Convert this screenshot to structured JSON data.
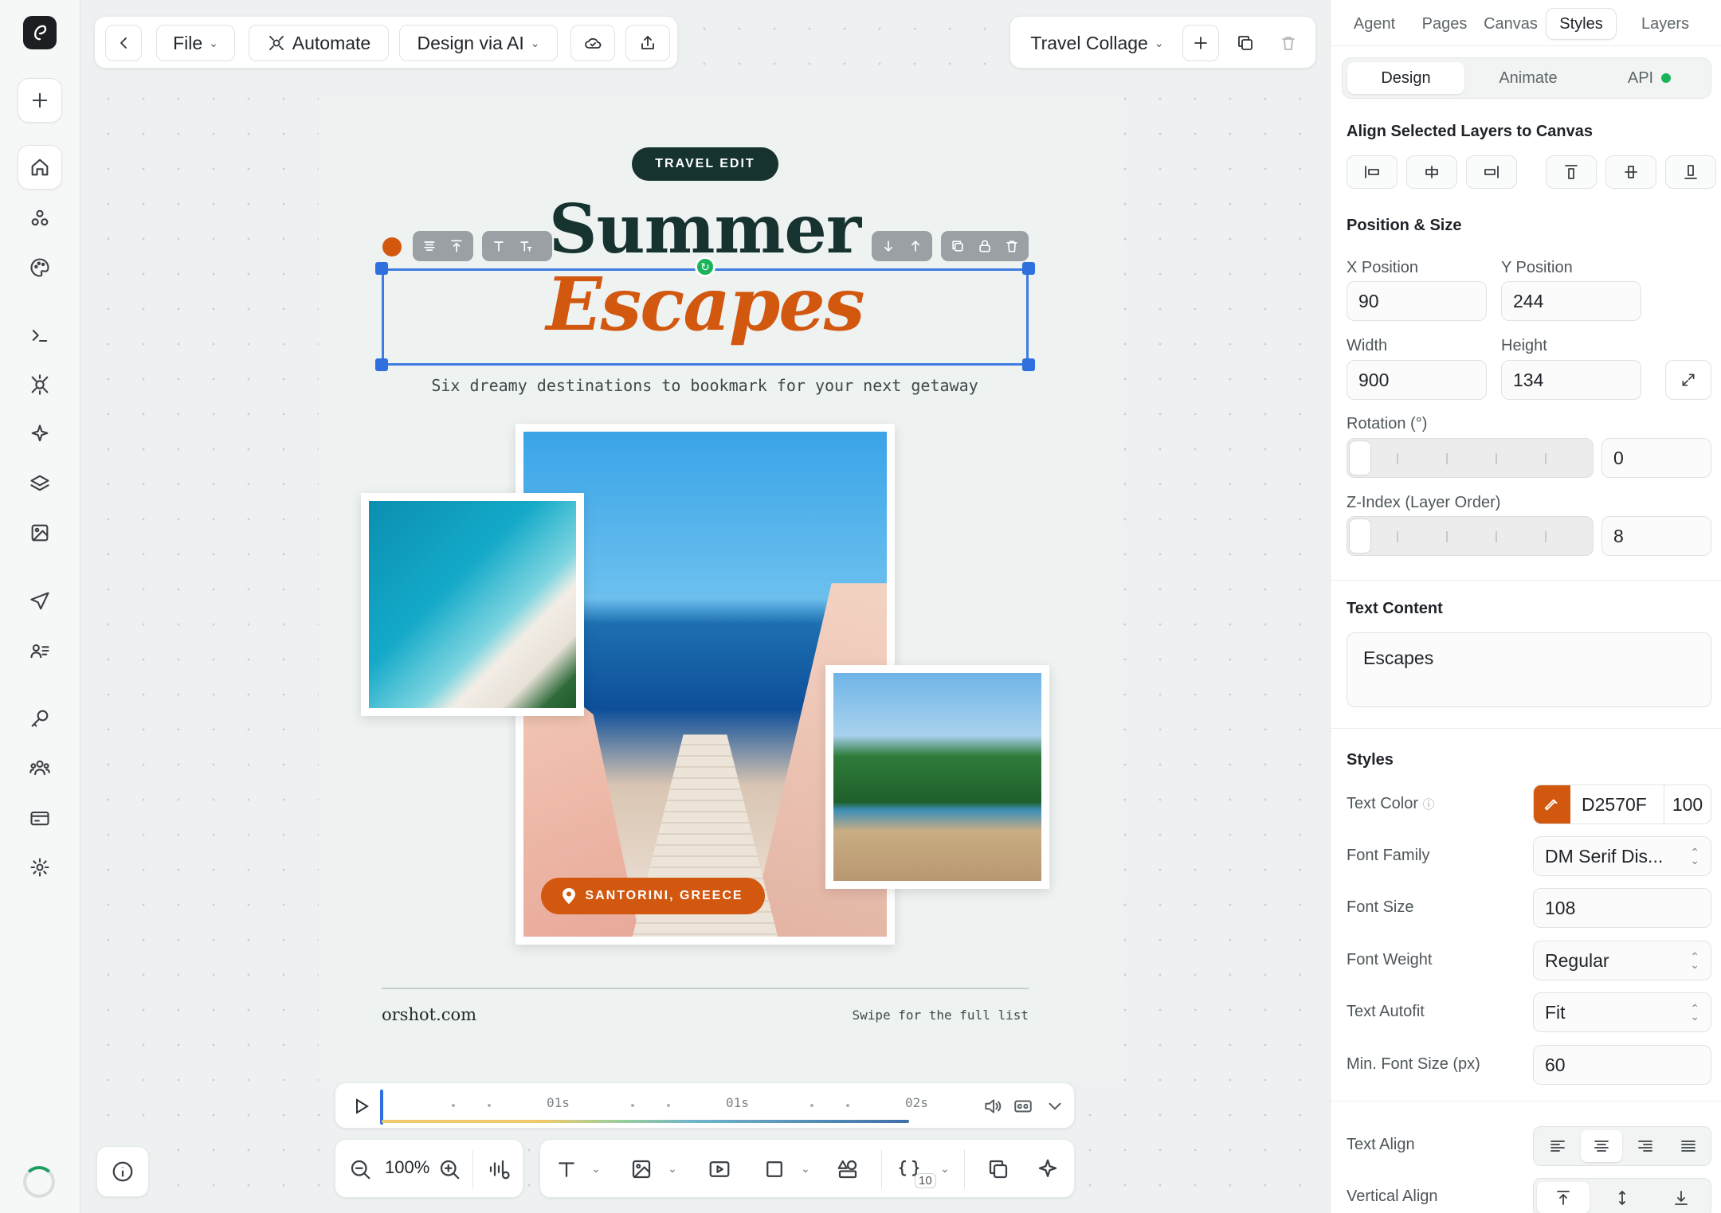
{
  "topbar": {
    "file_label": "File",
    "automate_label": "Automate",
    "design_ai_label": "Design via AI",
    "project_name": "Travel Collage"
  },
  "canvas": {
    "tag": "TRAVEL EDIT",
    "title_line1": "Summer",
    "title_line2": "Escapes",
    "subtitle": "Six dreamy destinations to bookmark for your next getaway",
    "location": "SANTORINI, GREECE",
    "footer_left": "orshot.com",
    "footer_right": "Swipe for the full list",
    "accent_color": "#D2570F",
    "dark_color": "#163330"
  },
  "timeline": {
    "marks": [
      "01s",
      "01s",
      "02s"
    ]
  },
  "bottombar": {
    "zoom": "100%",
    "variables_count": "10"
  },
  "panel": {
    "tabs": [
      "Agent",
      "Pages",
      "Canvas",
      "Styles",
      "Layers"
    ],
    "active_tab": "Styles",
    "subtabs": [
      "Design",
      "Animate",
      "API"
    ],
    "active_subtab": "Design",
    "align_title": "Align Selected Layers to Canvas",
    "position_title": "Position & Size",
    "x_label": "X Position",
    "x_value": "90",
    "y_label": "Y Position",
    "y_value": "244",
    "width_label": "Width",
    "width_value": "900",
    "height_label": "Height",
    "height_value": "134",
    "rotation_label": "Rotation (°)",
    "rotation_value": "0",
    "zindex_label": "Z-Index (Layer Order)",
    "zindex_value": "8",
    "text_content_title": "Text Content",
    "text_content_value": "Escapes",
    "styles_title": "Styles",
    "text_color_label": "Text Color",
    "text_color_hex": "D2570F",
    "text_color_opacity": "100",
    "font_family_label": "Font Family",
    "font_family_value": "DM Serif Dis...",
    "font_size_label": "Font Size",
    "font_size_value": "108",
    "font_weight_label": "Font Weight",
    "font_weight_value": "Regular",
    "text_autofit_label": "Text Autofit",
    "text_autofit_value": "Fit",
    "min_font_label": "Min. Font Size (px)",
    "min_font_value": "60",
    "text_align_label": "Text Align",
    "vertical_align_label": "Vertical Align"
  }
}
